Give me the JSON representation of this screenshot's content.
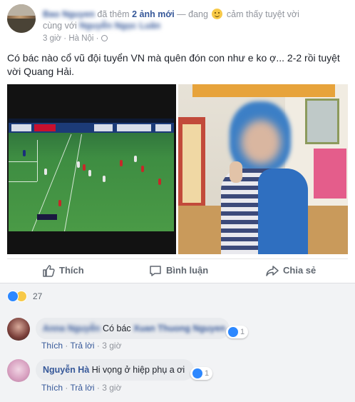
{
  "post": {
    "author_name": "Bao Nguyen",
    "action_text": "đã thêm",
    "photo_count": "2 ảnh mới",
    "feeling_prefix": "— đang",
    "feeling_text": "cảm thấy tuyệt vời",
    "with_prefix": "cùng với",
    "tagged_name": "Nguyễn Ngọc Luân",
    "time": "3 giờ",
    "location": "Hà Nội",
    "text": "Có bác nào cổ vũ đội tuyển VN mà quên đón con như e ko ợ... 2-2 rồi tuyệt vời Quang Hải."
  },
  "actions": {
    "like": "Thích",
    "comment": "Bình luận",
    "share": "Chia sẻ"
  },
  "reactions": {
    "count": "27",
    "icons": [
      "like-icon",
      "haha-icon"
    ]
  },
  "comments": [
    {
      "author": "Anna Nguyễn",
      "text_prefix": "Có bác",
      "mention": "Xuan Thuong Nguyen",
      "reactions": "1",
      "like_label": "Thích",
      "reply_label": "Trả lời",
      "time": "3 giờ"
    },
    {
      "author": "Nguyễn Hà",
      "text": "Hi vọng ở hiệp phụ a ơi",
      "reactions": "1",
      "like_label": "Thích",
      "reply_label": "Trả lời",
      "time": "3 giờ"
    }
  ],
  "colors": {
    "link": "#365899",
    "muted": "#90949c",
    "action": "#606770",
    "like_blue": "#2d88ff"
  }
}
